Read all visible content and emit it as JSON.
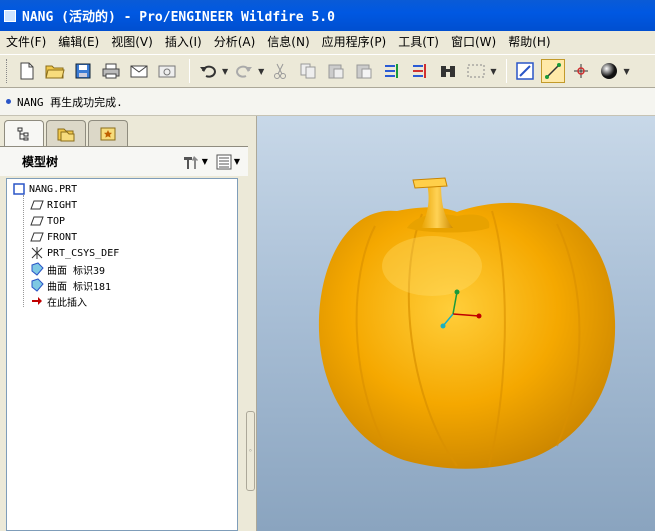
{
  "window": {
    "title": "NANG (活动的) - Pro/ENGINEER Wildfire 5.0"
  },
  "menu": [
    {
      "label": "文件(F)"
    },
    {
      "label": "编辑(E)"
    },
    {
      "label": "视图(V)"
    },
    {
      "label": "插入(I)"
    },
    {
      "label": "分析(A)"
    },
    {
      "label": "信息(N)"
    },
    {
      "label": "应用程序(P)"
    },
    {
      "label": "工具(T)"
    },
    {
      "label": "窗口(W)"
    },
    {
      "label": "帮助(H)"
    }
  ],
  "message": {
    "text": "NANG 再生成功完成."
  },
  "navigator": {
    "tree_title": "模型树",
    "root": "NANG.PRT",
    "items": [
      {
        "label": "RIGHT",
        "icon": "datum-plane-icon"
      },
      {
        "label": "TOP",
        "icon": "datum-plane-icon"
      },
      {
        "label": "FRONT",
        "icon": "datum-plane-icon"
      },
      {
        "label": "PRT_CSYS_DEF",
        "icon": "coordinate-system-icon"
      },
      {
        "label": "曲面 标识39",
        "icon": "surface-icon"
      },
      {
        "label": "曲面 标识181",
        "icon": "surface-icon"
      },
      {
        "label": "在此插入",
        "icon": "insert-here-arrow-icon"
      }
    ]
  },
  "colors": {
    "titlebar": "#0058e2",
    "model": "#f5a800",
    "viewport_top": "#c8d8e8",
    "viewport_bottom": "#8aa4bf"
  }
}
